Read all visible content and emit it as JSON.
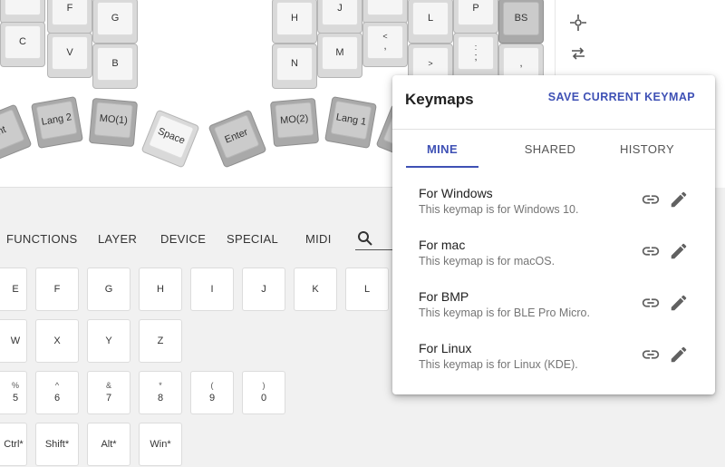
{
  "keyboard": {
    "left_keys": [
      {
        "label": "F",
        "sub": "",
        "dark": false
      },
      {
        "label": "G",
        "sub": "",
        "dark": false
      },
      {
        "label": "C",
        "sub": "",
        "dark": false
      },
      {
        "label": "V",
        "sub": "",
        "dark": false
      },
      {
        "label": "B",
        "sub": "",
        "dark": false
      }
    ],
    "right_keys": [
      {
        "label": "H",
        "sub": "",
        "dark": false
      },
      {
        "label": "J",
        "sub": "",
        "dark": false
      },
      {
        "label": "L",
        "sub": "",
        "dark": false
      },
      {
        "label": "P",
        "sub": "",
        "dark": false
      },
      {
        "label": "BS",
        "sub": "",
        "dark": true
      },
      {
        "label": "N",
        "sub": "",
        "dark": false
      },
      {
        "label": "M",
        "sub": "",
        "dark": false
      },
      {
        "label": ",",
        "sub": "<",
        "dark": false
      },
      {
        "label": ";",
        "sub": ":",
        "dark": false
      },
      {
        "label": ",",
        "sub": "",
        "dark": false
      },
      {
        "label": "",
        "sub": ">",
        "dark": false
      }
    ],
    "thumb_keys": [
      {
        "label": "nt",
        "dark": true
      },
      {
        "label": "Lang 2",
        "dark": true
      },
      {
        "label": "MO(1)",
        "dark": true
      },
      {
        "label": "Space",
        "dark": false
      },
      {
        "label": "Enter",
        "dark": true
      },
      {
        "label": "MO(2)",
        "dark": true
      },
      {
        "label": "Lang 1",
        "dark": true
      }
    ]
  },
  "rail": {
    "icons": [
      "crosshair-icon",
      "swap-horizontal-icon"
    ]
  },
  "categories": [
    "FUNCTIONS",
    "LAYER",
    "DEVICE",
    "SPECIAL",
    "MIDI"
  ],
  "palette": {
    "row1": [
      "E",
      "F",
      "G",
      "H",
      "I",
      "J",
      "K",
      "L"
    ],
    "row2": [
      "W",
      "X",
      "Y",
      "Z"
    ],
    "row3": [
      {
        "sub": "%",
        "label": "5"
      },
      {
        "sub": "^",
        "label": "6"
      },
      {
        "sub": "&",
        "label": "7"
      },
      {
        "sub": "*",
        "label": "8"
      },
      {
        "sub": "(",
        "label": "9"
      },
      {
        "sub": ")",
        "label": "0"
      }
    ],
    "row4": [
      "Ctrl*",
      "Shift*",
      "Alt*",
      "Win*"
    ]
  },
  "keymaps": {
    "title": "Keymaps",
    "save_label": "SAVE CURRENT KEYMAP",
    "tabs": [
      "MINE",
      "SHARED",
      "HISTORY"
    ],
    "active_tab": "MINE",
    "accent_color": "#3f51b5",
    "items": [
      {
        "name": "For Windows",
        "desc": "This keymap is for Windows 10."
      },
      {
        "name": "For mac",
        "desc": "This keymap is for macOS."
      },
      {
        "name": "For BMP",
        "desc": "This keymap is for BLE Pro Micro."
      },
      {
        "name": "For Linux",
        "desc": "This keymap is for Linux (KDE)."
      }
    ]
  }
}
